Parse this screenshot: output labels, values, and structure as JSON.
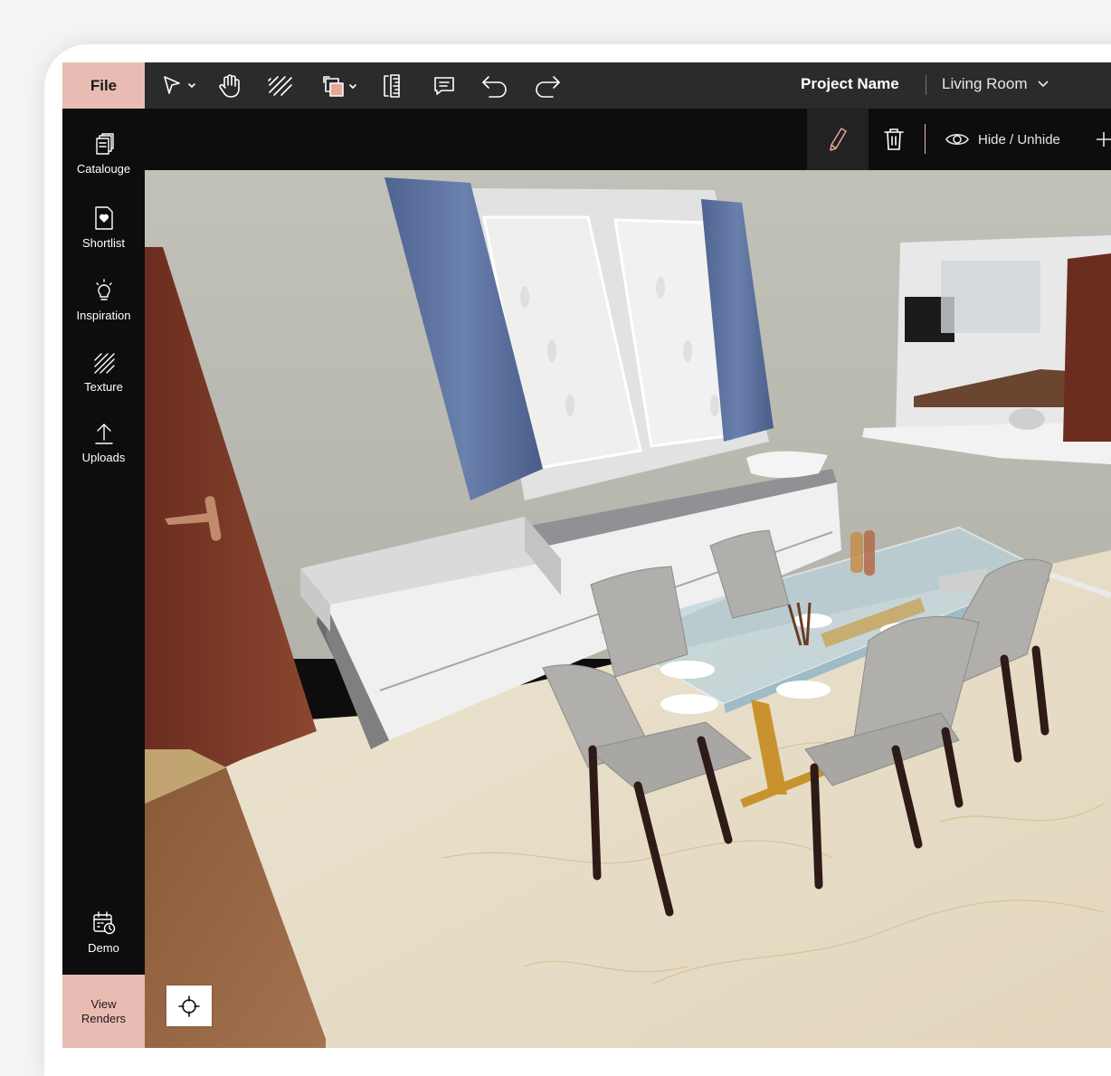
{
  "topbar": {
    "file_label": "File",
    "project_name": "Project Name",
    "room_name": "Living Room",
    "tools": [
      "select-icon",
      "pan-hand-icon",
      "texture-icon",
      "layers-icon",
      "ruler-icon",
      "comment-icon",
      "undo-icon",
      "redo-icon"
    ]
  },
  "subbar": {
    "hide_label": "Hide / Unhide"
  },
  "sidebar": {
    "items": [
      {
        "label": "Catalouge",
        "icon": "catalogue-icon"
      },
      {
        "label": "Shortlist",
        "icon": "shortlist-icon"
      },
      {
        "label": "Inspiration",
        "icon": "lightbulb-icon"
      },
      {
        "label": "Texture",
        "icon": "texture-icon"
      },
      {
        "label": "Uploads",
        "icon": "upload-icon"
      }
    ],
    "demo_label": "Demo",
    "view_renders_line1": "View",
    "view_renders_line2": "Renders"
  },
  "colors": {
    "accent": "#e9bcb3",
    "toolbar": "#2b2b2b",
    "sidebar": "#0d0d0d",
    "wall": "#b9b9b1",
    "floor": "#e6dcc7",
    "curtain": "#5a6e98"
  }
}
